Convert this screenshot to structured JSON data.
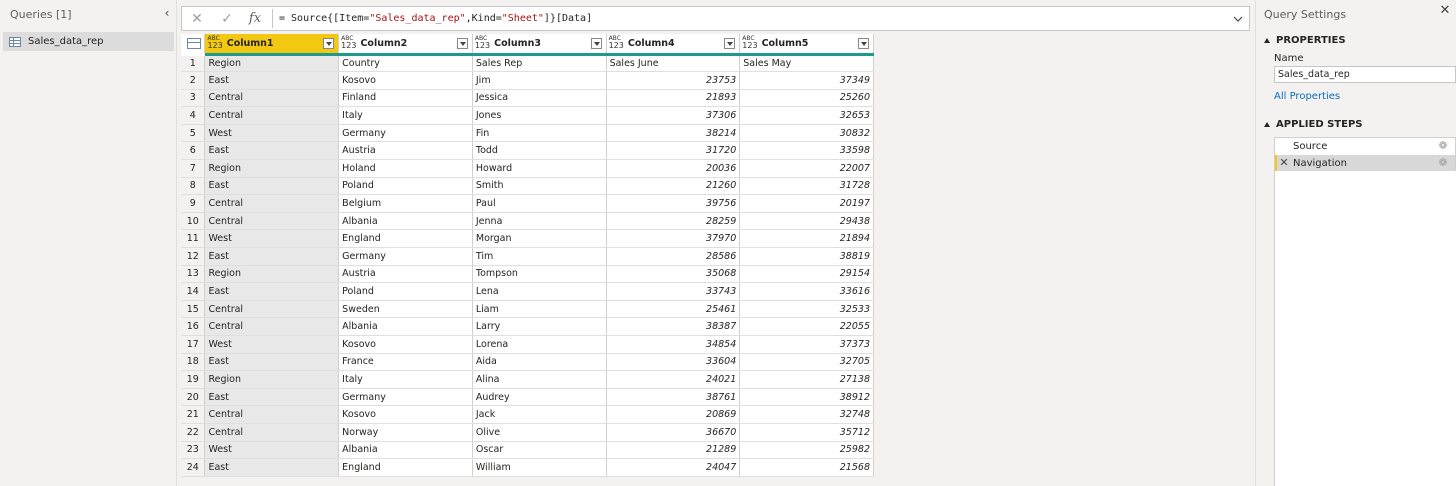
{
  "queries": {
    "title": "Queries [1]",
    "items": [
      {
        "label": "Sales_data_rep"
      }
    ]
  },
  "formula": {
    "prefix": "= Source{[Item=",
    "item_value": "\"Sales_data_rep\"",
    "mid": ",Kind=",
    "kind_value": "\"Sheet\"",
    "suffix": "]}[Data]"
  },
  "grid": {
    "columns": [
      {
        "type_top": "ABC",
        "type_bottom": "123",
        "label": "Column1"
      },
      {
        "type_top": "ABC",
        "type_bottom": "123",
        "label": "Column2"
      },
      {
        "type_top": "ABC",
        "type_bottom": "123",
        "label": "Column3"
      },
      {
        "type_top": "ABC",
        "type_bottom": "123",
        "label": "Column4"
      },
      {
        "type_top": "ABC",
        "type_bottom": "123",
        "label": "Column5"
      }
    ],
    "rows": [
      [
        "1",
        "Region",
        "Country",
        "Sales Rep",
        "Sales June",
        "Sales May"
      ],
      [
        "2",
        "East",
        "Kosovo",
        "Jim",
        "23753",
        "37349"
      ],
      [
        "3",
        "Central",
        "Finland",
        "Jessica",
        "21893",
        "25260"
      ],
      [
        "4",
        "Central",
        "Italy",
        "Jones",
        "37306",
        "32653"
      ],
      [
        "5",
        "West",
        "Germany",
        "Fin",
        "38214",
        "30832"
      ],
      [
        "6",
        "East",
        "Austria",
        "Todd",
        "31720",
        "33598"
      ],
      [
        "7",
        "Region",
        "Holand",
        "Howard",
        "20036",
        "22007"
      ],
      [
        "8",
        "East",
        "Poland",
        "Smith",
        "21260",
        "31728"
      ],
      [
        "9",
        "Central",
        "Belgium",
        "Paul",
        "39756",
        "20197"
      ],
      [
        "10",
        "Central",
        "Albania",
        "Jenna",
        "28259",
        "29438"
      ],
      [
        "11",
        "West",
        "England",
        "Morgan",
        "37970",
        "21894"
      ],
      [
        "12",
        "East",
        "Germany",
        "Tim",
        "28586",
        "38819"
      ],
      [
        "13",
        "Region",
        "Austria",
        "Tompson",
        "35068",
        "29154"
      ],
      [
        "14",
        "East",
        "Poland",
        "Lena",
        "33743",
        "33616"
      ],
      [
        "15",
        "Central",
        "Sweden",
        "Liam",
        "25461",
        "32533"
      ],
      [
        "16",
        "Central",
        "Albania",
        "Larry",
        "38387",
        "22055"
      ],
      [
        "17",
        "West",
        "Kosovo",
        "Lorena",
        "34854",
        "37373"
      ],
      [
        "18",
        "East",
        "France",
        "Aida",
        "33604",
        "32705"
      ],
      [
        "19",
        "Region",
        "Italy",
        "Alina",
        "24021",
        "27138"
      ],
      [
        "20",
        "East",
        "Germany",
        "Audrey",
        "38761",
        "38912"
      ],
      [
        "21",
        "Central",
        "Kosovo",
        "Jack",
        "20869",
        "32748"
      ],
      [
        "22",
        "Central",
        "Norway",
        "Olive",
        "36670",
        "35712"
      ],
      [
        "23",
        "West",
        "Albania",
        "Oscar",
        "21289",
        "25982"
      ],
      [
        "24",
        "East",
        "England",
        "William",
        "24047",
        "21568"
      ]
    ]
  },
  "settings": {
    "title": "Query Settings",
    "properties_heading": "PROPERTIES",
    "name_label": "Name",
    "name_value": "Sales_data_rep",
    "all_properties": "All Properties",
    "steps_heading": "APPLIED STEPS",
    "steps": [
      {
        "label": "Source",
        "active": false
      },
      {
        "label": "Navigation",
        "active": true
      }
    ]
  },
  "colors": {
    "selected_column": "#f2c811",
    "quality_bar": "#1d9a8c",
    "link": "#0f6cbd"
  }
}
